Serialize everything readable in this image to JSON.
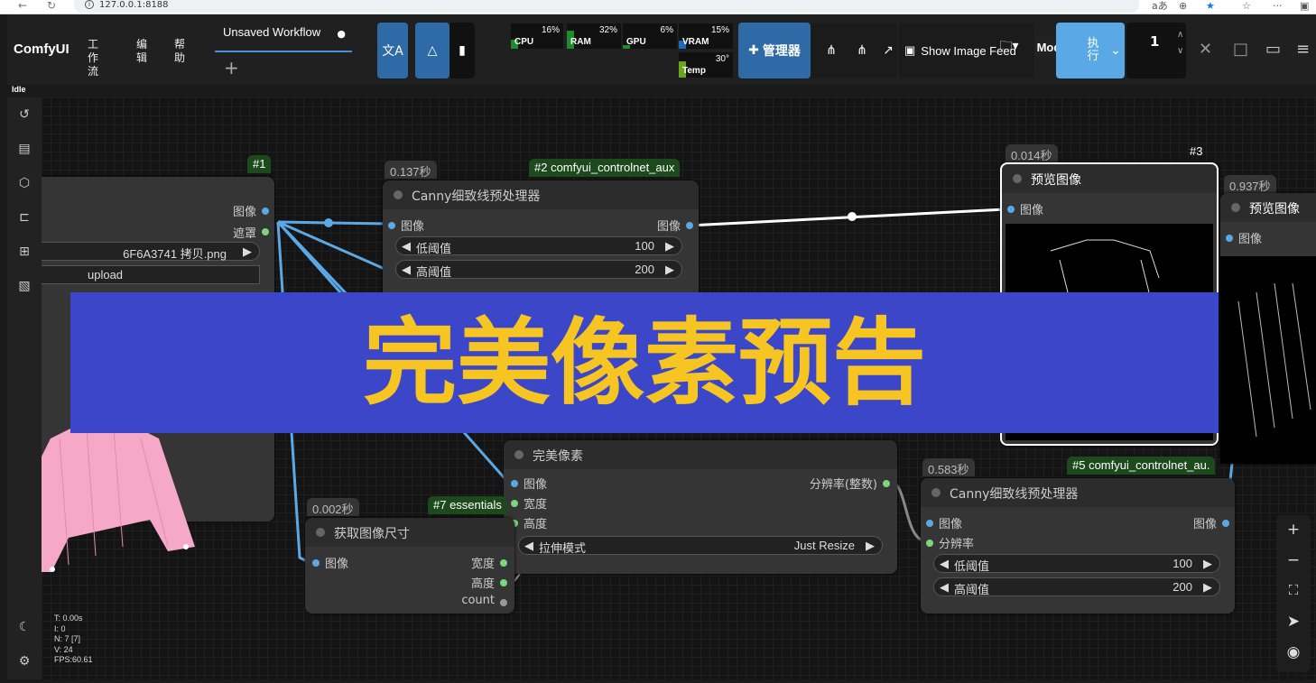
{
  "browser": {
    "url": "127.0.0.1:8188"
  },
  "app": {
    "name": "ComfyUI",
    "menu": [
      "工作流",
      "编辑",
      "帮助"
    ],
    "status": "Idle"
  },
  "workflow_tab": {
    "title": "Unsaved Workflow",
    "dot": "●"
  },
  "monitors": [
    {
      "label": "CPU",
      "value": "16%",
      "level": 0.16
    },
    {
      "label": "RAM",
      "value": "32%",
      "level": 0.32
    },
    {
      "label": "GPU",
      "value": "6%",
      "level": 0.06
    },
    {
      "label": "VRAM",
      "value": "15%",
      "level": 0.15
    },
    {
      "label": "Temp",
      "value": "30°",
      "level": 0.3
    }
  ],
  "toolbar": {
    "manager": "管理器",
    "show_image_feed": "Show Image Feed",
    "models": "Models",
    "run": "执行",
    "batch_count": "1"
  },
  "colors": {
    "accent": "#3a7bbf",
    "overlay_bg": "#3b46c8",
    "overlay_text": "#f6c521",
    "link": "#5aa9e6"
  },
  "nodes": {
    "load": {
      "id": "#1",
      "outputs": [
        "图像",
        "遮罩"
      ],
      "file": "6F6A3741 拷贝.png",
      "upload": "upload"
    },
    "canny2": {
      "time": "0.137秒",
      "badge": "#2 comfyui_controlnet_aux",
      "title": "Canny细致线预处理器",
      "input": "图像",
      "output": "图像",
      "low_label": "低阈值",
      "low_value": "100",
      "high_label": "高阈值",
      "high_value": "200"
    },
    "preview3": {
      "time": "0.014秒",
      "id": "#3",
      "title": "预览图像",
      "input": "图像"
    },
    "preview4": {
      "time": "0.937秒",
      "title": "预览图像",
      "input": "图像"
    },
    "perfect": {
      "title": "完美像素",
      "inputs": [
        "图像",
        "宽度",
        "高度"
      ],
      "output": "分辨率(整数)",
      "mode_label": "拉伸模式",
      "mode_value": "Just Resize"
    },
    "size": {
      "time": "0.002秒",
      "badge": "#7 essentials",
      "title": "获取图像尺寸",
      "input": "图像",
      "outputs": [
        "宽度",
        "高度",
        "count"
      ]
    },
    "canny5": {
      "time": "0.583秒",
      "badge": "#5 comfyui_controlnet_au.",
      "title": "Canny细致线预处理器",
      "inputs": [
        "图像",
        "分辨率"
      ],
      "output": "图像",
      "low_label": "低阈值",
      "low_value": "100",
      "high_label": "高阈值",
      "high_value": "200"
    }
  },
  "overlay_text": "完美像素预告",
  "stats": [
    "T: 0.00s",
    "I: 0",
    "N: 7 [7]",
    "V: 24",
    "FPS:60.61"
  ]
}
